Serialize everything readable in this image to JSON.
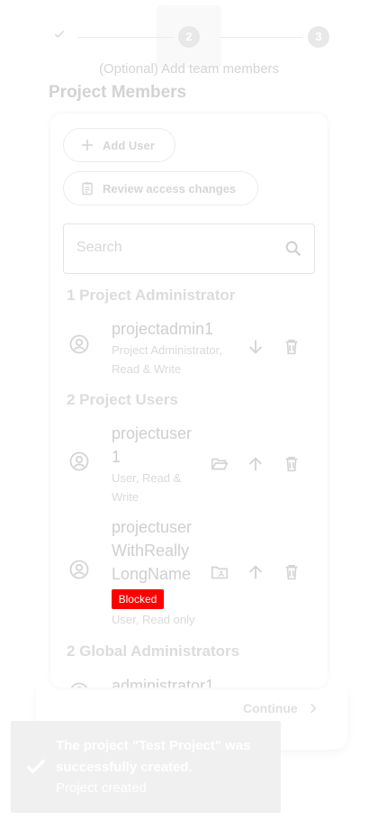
{
  "stepper": {
    "steps": [
      {
        "number": "",
        "state": "completed",
        "icon": "check-icon"
      },
      {
        "number": "2",
        "state": "active"
      },
      {
        "number": "3",
        "state": "upcoming"
      }
    ],
    "current_label": "(Optional) Add team members"
  },
  "section_title": "Project Members",
  "actions": {
    "add_user": {
      "label": "Add User",
      "icon": "plus-icon"
    },
    "review_access": {
      "label": "Review access changes",
      "icon": "clipboard-icon"
    }
  },
  "search": {
    "placeholder": "Search",
    "value": "",
    "icon": "search-icon"
  },
  "groups": [
    {
      "header": "1 Project Administrator",
      "members": [
        {
          "name": "projectadmin1",
          "role": "Project Administrator, Read & Write",
          "actions": [
            "move-down-icon",
            "delete-icon"
          ]
        }
      ]
    },
    {
      "header": "2 Project Users",
      "members": [
        {
          "name": "projectuser1",
          "role": "User, Read & Write",
          "actions": [
            "folder-open-icon",
            "move-up-icon",
            "delete-icon"
          ]
        },
        {
          "name": "projectuserWithReallyLongName",
          "badge": "Blocked",
          "role": "User, Read only",
          "actions": [
            "folder-shared-icon",
            "move-up-icon",
            "delete-icon"
          ]
        }
      ]
    },
    {
      "header": "2 Global Administrators",
      "members": [
        {
          "name": "administrator1"
        }
      ]
    }
  ],
  "continue": {
    "label": "Continue",
    "icon": "chevron-right-icon"
  },
  "toast": {
    "message": "The project \"Test Project\" was successfully created.",
    "subtext": "Project created",
    "icon": "check-icon"
  },
  "colors": {
    "blocked_badge": "#ff0000",
    "toast_background": "#f0f0f0",
    "faded_text": "#d3d3d3"
  }
}
